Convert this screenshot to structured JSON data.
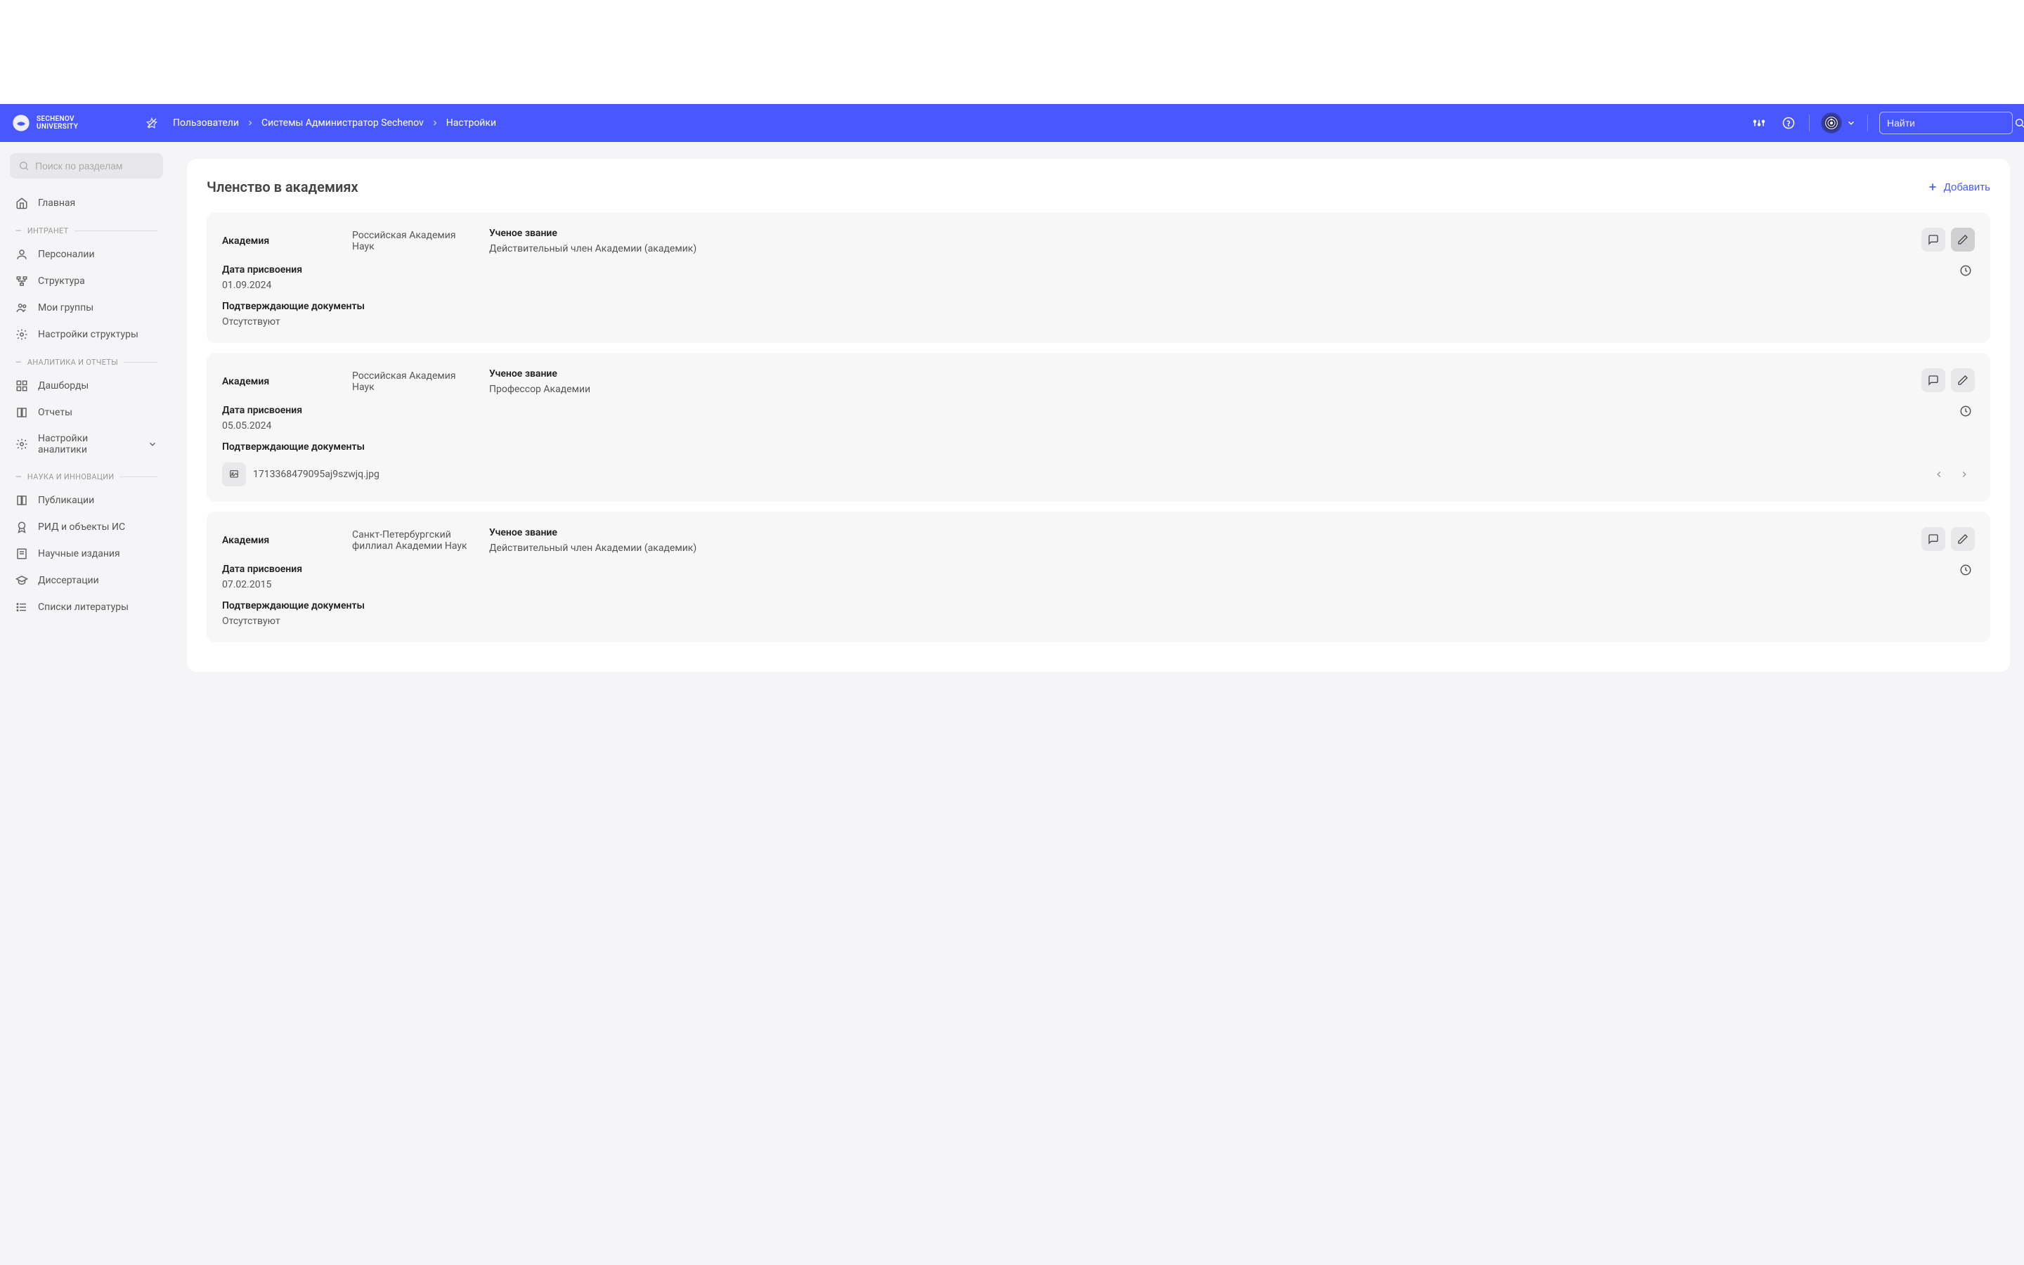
{
  "header": {
    "logo_line1": "SECHENOV",
    "logo_line2": "UNIVERSITY",
    "search_placeholder": "Найти"
  },
  "breadcrumb": {
    "items": [
      "Пользователи",
      "Системы Администратор Sechenov",
      "Настройки"
    ]
  },
  "sidebar": {
    "search_placeholder": "Поиск по разделам",
    "home": "Главная",
    "sections": {
      "intranet": {
        "title": "ИНТРАНЕТ",
        "items": [
          "Персоналии",
          "Структура",
          "Мои группы",
          "Настройки структуры"
        ]
      },
      "analytics": {
        "title": "АНАЛИТИКА И ОТЧЕТЫ",
        "items": [
          "Дашборды",
          "Отчеты",
          "Настройки аналитики"
        ]
      },
      "science": {
        "title": "НАУКА И ИННОВАЦИИ",
        "items": [
          "Публикации",
          "РИД и объекты ИС",
          "Научные издания",
          "Диссертации",
          "Списки литературы"
        ]
      }
    }
  },
  "section": {
    "title": "Членство в академиях",
    "add_label": "Добавить",
    "labels": {
      "academy": "Академия",
      "rank": "Ученое звание",
      "date": "Дата присвоения",
      "docs": "Подтверждающие документы",
      "none": "Отсутствуют"
    },
    "cards": [
      {
        "academy": "Российская Академия Наук",
        "rank": "Действительный член Академии (академик)",
        "date": "01.09.2024",
        "docs": []
      },
      {
        "academy": "Российская Академия Наук",
        "rank": "Профессор Академии",
        "date": "05.05.2024",
        "docs": [
          "1713368479095aj9szwjq.jpg"
        ]
      },
      {
        "academy": "Санкт-Петербургский филлиал Академии Наук",
        "rank": "Действительный член Академии (академик)",
        "date": "07.02.2015",
        "docs": []
      }
    ]
  }
}
